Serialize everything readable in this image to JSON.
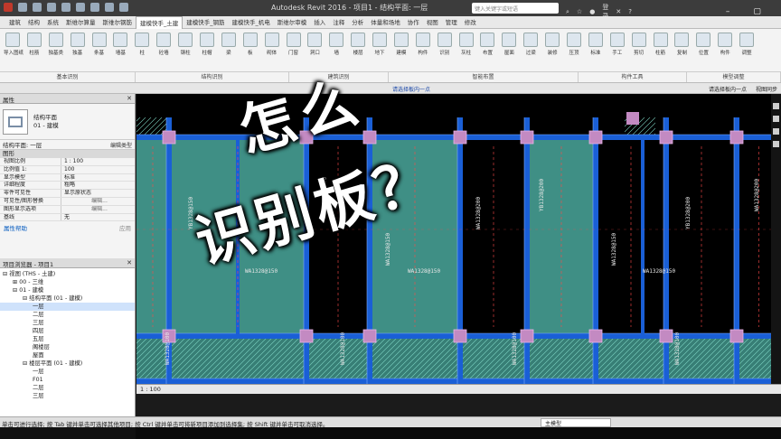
{
  "window": {
    "title": "Autodesk Revit 2016 -   项目1 - 结构平面: 一层",
    "search_placeholder": "键入关键字或短语",
    "login_label": "登录"
  },
  "ribbon": {
    "tabs": [
      "建筑",
      "结构",
      "系统",
      "斯维尔算量",
      "斯维尔钢筋",
      "建模快手_土建",
      "建模快手_钢筋",
      "建模快手_机电",
      "斯维尔审模",
      "插入",
      "注释",
      "分析",
      "体量和场地",
      "协作",
      "视图",
      "管理",
      "修改"
    ],
    "active_tab": "建模快手_土建",
    "tools": [
      "导入图纸",
      "柱筋",
      "独基类",
      "独基",
      "条基",
      "墙基",
      "柱",
      "砼墙",
      "钢柱",
      "柱帽",
      "梁",
      "板",
      "砌体",
      "门窗",
      "洞口",
      "墙",
      "楼层",
      "地下",
      "建模",
      "构件",
      "识别",
      "灰柱",
      "布置",
      "屋面",
      "过梁",
      "装修",
      "压顶",
      "标准",
      "手工",
      "剪切",
      "柱筋",
      "复制",
      "位置",
      "构件",
      "调整"
    ],
    "groups": [
      "基本识别",
      "结构识别",
      "建筑识别",
      "智能布置",
      "构件工具",
      "模型调整"
    ]
  },
  "options_bar": {
    "hint": "请选择板内一点",
    "right_label": "请选择板内一点",
    "sync_label": "视图同步"
  },
  "properties": {
    "header": "属性",
    "type_line1": "结构平面",
    "type_line2": "01 - 建模",
    "selector": "结构平面: 一层",
    "edit_type": "编辑类型",
    "section": "图形",
    "rows": [
      {
        "k": "视图比例",
        "v": "1 : 100"
      },
      {
        "k": "比例值 1:",
        "v": "100"
      },
      {
        "k": "显示模型",
        "v": "标准"
      },
      {
        "k": "详细程度",
        "v": "粗略"
      },
      {
        "k": "零件可见性",
        "v": "显示原状态"
      },
      {
        "k": "可见性/图形替换",
        "v": "编辑..."
      },
      {
        "k": "图形显示选项",
        "v": "编辑..."
      },
      {
        "k": "基线",
        "v": "无"
      }
    ],
    "help_link": "属性帮助",
    "apply": "应用"
  },
  "browser": {
    "header": "项目浏览器 - 项目1",
    "items": [
      {
        "label": "视图 (THS - 土建)",
        "indent": 0,
        "toggle": "⊟"
      },
      {
        "label": "00 - 三维",
        "indent": 1,
        "toggle": "⊞"
      },
      {
        "label": "01 - 建模",
        "indent": 1,
        "toggle": "⊟"
      },
      {
        "label": "结构平面 (01 - 建模)",
        "indent": 2,
        "toggle": "⊟"
      },
      {
        "label": "一层",
        "indent": 3,
        "toggle": "",
        "selected": true
      },
      {
        "label": "二层",
        "indent": 3,
        "toggle": ""
      },
      {
        "label": "三层",
        "indent": 3,
        "toggle": ""
      },
      {
        "label": "四层",
        "indent": 3,
        "toggle": ""
      },
      {
        "label": "五层",
        "indent": 3,
        "toggle": ""
      },
      {
        "label": "阁楼层",
        "indent": 3,
        "toggle": ""
      },
      {
        "label": "屋面",
        "indent": 3,
        "toggle": ""
      },
      {
        "label": "楼层平面 (01 - 建模)",
        "indent": 2,
        "toggle": "⊟"
      },
      {
        "label": "一层",
        "indent": 3,
        "toggle": ""
      },
      {
        "label": "F01",
        "indent": 3,
        "toggle": ""
      },
      {
        "label": "二层",
        "indent": 3,
        "toggle": ""
      },
      {
        "label": "三层",
        "indent": 3,
        "toggle": ""
      }
    ]
  },
  "canvas": {
    "slab_labels": [
      "YB1328@150",
      "YB1328@200",
      "WA1328@200",
      "WA1328@150",
      "WA1328@100"
    ]
  },
  "view_bar": {
    "scale": "1 : 100"
  },
  "status": {
    "text": "单击可进行选择; 按 Tab 键并单击可选择其他项目; 按 Ctrl 键并单击可将新项目添加到选择集; 按 Shift 键并单击可取消选择。",
    "model": "主模型"
  },
  "overlay": {
    "line1": "怎么",
    "line2": "识别板？"
  },
  "colors": {
    "slab_fill": "#4aa89c",
    "beam": "#1a5fd6",
    "column": "#c38ac2",
    "label": "#e6e6e6"
  }
}
